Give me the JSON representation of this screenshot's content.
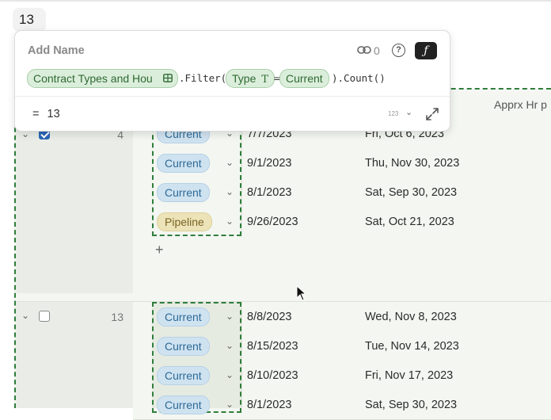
{
  "cell_value": "13",
  "popup": {
    "name_placeholder": "Add Name",
    "link_count": "0",
    "fx_label": "ƒ",
    "formula": {
      "column_token": "Contract Types and Hou",
      "filter_text": ".Filter(",
      "field_token": "Type",
      "equals": "=",
      "value_token": "Current",
      "tail_text": ").Count()"
    },
    "result_prefix": "=",
    "result_value": "13",
    "type_label": "123"
  },
  "table": {
    "column_header": "Apprx Hr p",
    "groups": [
      {
        "count": "4",
        "checked": true,
        "rows": [
          {
            "type": "Current",
            "date1": "7/7/2023",
            "date2": "Fri, Oct 6, 2023"
          },
          {
            "type": "Current",
            "date1": "9/1/2023",
            "date2": "Thu, Nov 30, 2023"
          },
          {
            "type": "Current",
            "date1": "8/1/2023",
            "date2": "Sat, Sep 30, 2023"
          },
          {
            "type": "Pipeline",
            "date1": "9/26/2023",
            "date2": "Sat, Oct 21, 2023"
          }
        ]
      },
      {
        "count": "13",
        "checked": false,
        "rows": [
          {
            "type": "Current",
            "date1": "8/8/2023",
            "date2": "Wed, Nov 8, 2023"
          },
          {
            "type": "Current",
            "date1": "8/15/2023",
            "date2": "Tue, Nov 14, 2023"
          },
          {
            "type": "Current",
            "date1": "8/10/2023",
            "date2": "Fri, Nov 17, 2023"
          },
          {
            "type": "Current",
            "date1": "8/1/2023",
            "date2": "Sat, Sep 30, 2023"
          }
        ]
      }
    ],
    "add_label": "+"
  },
  "icons": {
    "link": "link-icon",
    "help": "help-icon",
    "formula": "function-icon",
    "expand": "expand-icon",
    "chevron": "chevron-down-icon",
    "cursor": "mouse-pointer-icon"
  },
  "colors": {
    "group_dash": "#2f7d3b",
    "chip_current_bg": "#cfe2f0",
    "chip_current_text": "#2d6b97",
    "chip_pipeline_bg": "#ece3b8",
    "chip_pipeline_text": "#7a6525",
    "formula_token_bg": "#dbeedb",
    "checkbox_checked": "#2b66b5"
  }
}
